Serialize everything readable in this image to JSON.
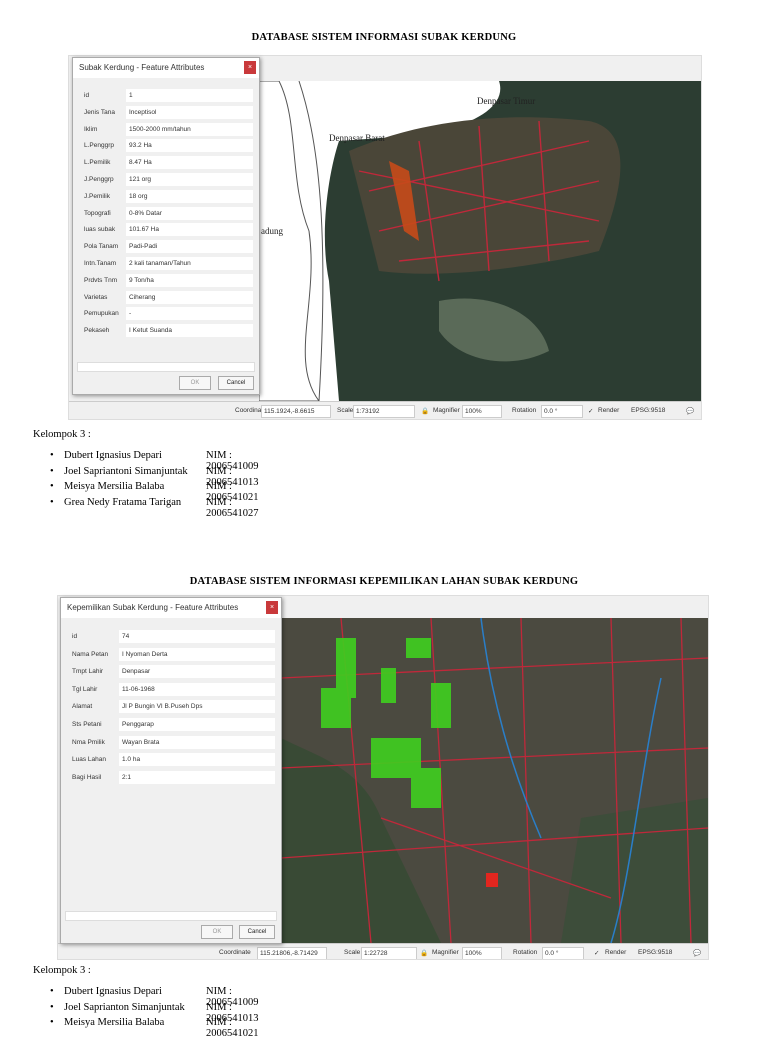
{
  "section1": {
    "title": "DATABASE SISTEM INFORMASI SUBAK KERDUNG",
    "dialog": {
      "title": "Subak Kerdung  - Feature Attributes",
      "close": "×",
      "ok": "OK",
      "cancel": "Cancel",
      "fields": [
        [
          "id",
          "1"
        ],
        [
          "Jenis Tana",
          "Inceptisol"
        ],
        [
          "Iklim",
          "1500-2000 mm/tahun"
        ],
        [
          "L.Penggrp",
          "93.2 Ha"
        ],
        [
          "L.Pemilik",
          "8.47 Ha"
        ],
        [
          "J.Penggrp",
          "121 org"
        ],
        [
          "J.Pemilik",
          "18 org"
        ],
        [
          "Topografi",
          "0-8% Datar"
        ],
        [
          "luas subak",
          "101.67 Ha"
        ],
        [
          "Pola Tanam",
          "Padi-Padi"
        ],
        [
          "Intn.Tanam",
          "2 kali tanaman/Tahun"
        ],
        [
          "Prdvts Tnm",
          "9 Ton/ha"
        ],
        [
          "Varietas",
          "Ciherang"
        ],
        [
          "Pemupukan",
          "-"
        ],
        [
          "Pekaseh",
          "I Ketut Suanda"
        ]
      ]
    },
    "map_labels": [
      "Denpasar Timur",
      "Denpasar Barat",
      "adung"
    ],
    "statusbar": {
      "coordinate_label": "Coordinate",
      "coordinate": "115.1924,-8.6615",
      "scale_label": "Scale",
      "scale": "1:73192",
      "magnifier_label": "Magnifier",
      "magnifier": "100%",
      "rotation_label": "Rotation",
      "rotation": "0.0 °",
      "render_label": "Render",
      "crs": "EPSG:9518"
    },
    "group": "Kelompok 3 :",
    "members": [
      [
        "Dubert Ignasius Depari",
        "NIM : 2006541009"
      ],
      [
        "Joel Sapriantoni Simanjuntak",
        "NIM : 2006541013"
      ],
      [
        "Meisya Mersilia Balaba",
        "NIM : 2006541021"
      ],
      [
        "Grea Nedy Fratama Tarigan",
        "NIM : 2006541027"
      ]
    ]
  },
  "section2": {
    "title": "DATABASE SISTEM INFORMASI KEPEMILIKAN LAHAN SUBAK KERDUNG",
    "dialog": {
      "title": "Kepemilikan Subak Kerdung - Feature Attributes",
      "close": "×",
      "ok": "OK",
      "cancel": "Cancel",
      "fields": [
        [
          "id",
          "74"
        ],
        [
          "Nama Petan",
          "I Nyoman Derta"
        ],
        [
          "Tmpt Lahir",
          "Denpasar"
        ],
        [
          "Tgl Lahir",
          "11-06-1968"
        ],
        [
          "Alamat",
          "Jl P Bungin VI B.Puseh Dps"
        ],
        [
          "Sts Petani",
          "Penggarap"
        ],
        [
          "Nma Pmilik",
          "Wayan Brata"
        ],
        [
          "Luas Lahan",
          "1.0 ha"
        ],
        [
          "Bagi Hasil",
          "2:1"
        ]
      ]
    },
    "statusbar": {
      "coordinate_label": "Coordinate",
      "coordinate": "115.21806,-8.71429",
      "scale_label": "Scale",
      "scale": "1:22728",
      "magnifier_label": "Magnifier",
      "magnifier": "100%",
      "rotation_label": "Rotation",
      "rotation": "0.0 °",
      "render_label": "Render",
      "crs": "EPSG:9518"
    },
    "group": "Kelompok 3 :",
    "members": [
      [
        "Dubert Ignasius Depari",
        "NIM : 2006541009"
      ],
      [
        "Joel Saprianton Simanjuntak",
        "NIM : 2006541013"
      ],
      [
        "Meisya Mersilia Balaba",
        "NIM : 2006541021"
      ]
    ]
  },
  "colors": {
    "close_button": "#c9393b",
    "roads": "#c0283a",
    "parcels": "#3fcf1f"
  }
}
